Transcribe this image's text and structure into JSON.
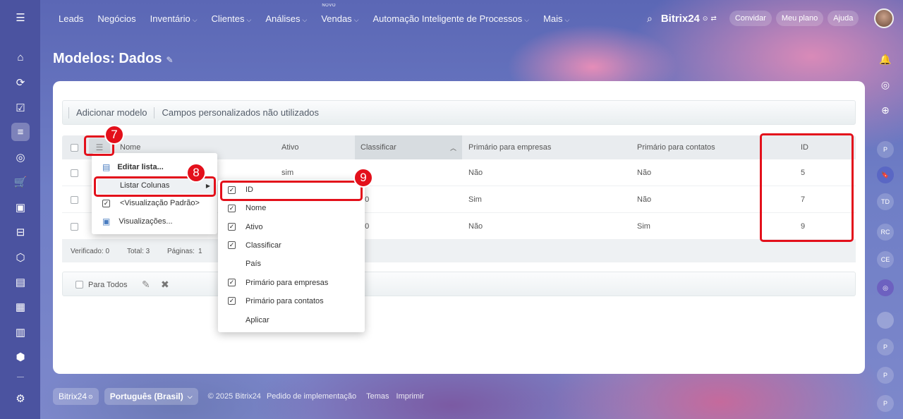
{
  "nav": {
    "items": [
      {
        "label": "Leads",
        "dropdown": false
      },
      {
        "label": "Negócios",
        "dropdown": false
      },
      {
        "label": "Inventário",
        "dropdown": true
      },
      {
        "label": "Clientes",
        "dropdown": true
      },
      {
        "label": "Análises",
        "dropdown": true
      },
      {
        "label": "Vendas",
        "dropdown": true,
        "badge": "NOVO"
      },
      {
        "label": "Automação Inteligente de Processos",
        "dropdown": true
      },
      {
        "label": "Mais",
        "dropdown": true
      }
    ],
    "brand": "Bitrix",
    "brand_num": "24",
    "invite": "Convidar",
    "plan": "Meu plano",
    "help": "Ajuda"
  },
  "page": {
    "title": "Modelos: Dados"
  },
  "toolbar": {
    "add": "Adicionar modelo",
    "unused": "Campos personalizados não utilizados"
  },
  "grid": {
    "columns": [
      "Nome",
      "Ativo",
      "Classificar",
      "Primário para empresas",
      "Primário para contatos",
      "ID"
    ],
    "rows": [
      {
        "name": "",
        "active": "sim",
        "sort": "0",
        "companies": "Não",
        "contacts": "Não",
        "id": "5"
      },
      {
        "name": "",
        "active": "",
        "sort": "10",
        "companies": "Sim",
        "contacts": "Não",
        "id": "7"
      },
      {
        "name": "",
        "active": "",
        "sort": "20",
        "companies": "Não",
        "contacts": "Sim",
        "id": "9"
      }
    ],
    "footer": {
      "checked": "Verificado: 0",
      "total": "Total: 3",
      "pages": "Páginas:",
      "pages_val": "1"
    },
    "for_all": "Para Todos"
  },
  "settings_menu": {
    "edit_list": "Editar lista...",
    "list_columns": "Listar Colunas",
    "default_view": "<Visualização Padrão>",
    "views": "Visualizações..."
  },
  "columns_menu": {
    "items": [
      {
        "label": "ID",
        "checked": true
      },
      {
        "label": "Nome",
        "checked": true
      },
      {
        "label": "Ativo",
        "checked": true
      },
      {
        "label": "Classificar",
        "checked": true
      },
      {
        "label": "País",
        "checked": false
      },
      {
        "label": "Primário para empresas",
        "checked": true
      },
      {
        "label": "Primário para contatos",
        "checked": true
      }
    ],
    "apply": "Aplicar"
  },
  "markers": {
    "m7": "7",
    "m8": "8",
    "m9": "9"
  },
  "footer": {
    "bitrix": "Bitrix24",
    "language": "Português (Brasil)",
    "copyright": "© 2025 Bitrix24",
    "implementation": "Pedido de implementação",
    "themes": "Temas",
    "print": "Imprimir"
  },
  "rightbar": {
    "letters": [
      "P",
      "TD",
      "RC",
      "CE",
      "P",
      "P",
      "P"
    ]
  }
}
